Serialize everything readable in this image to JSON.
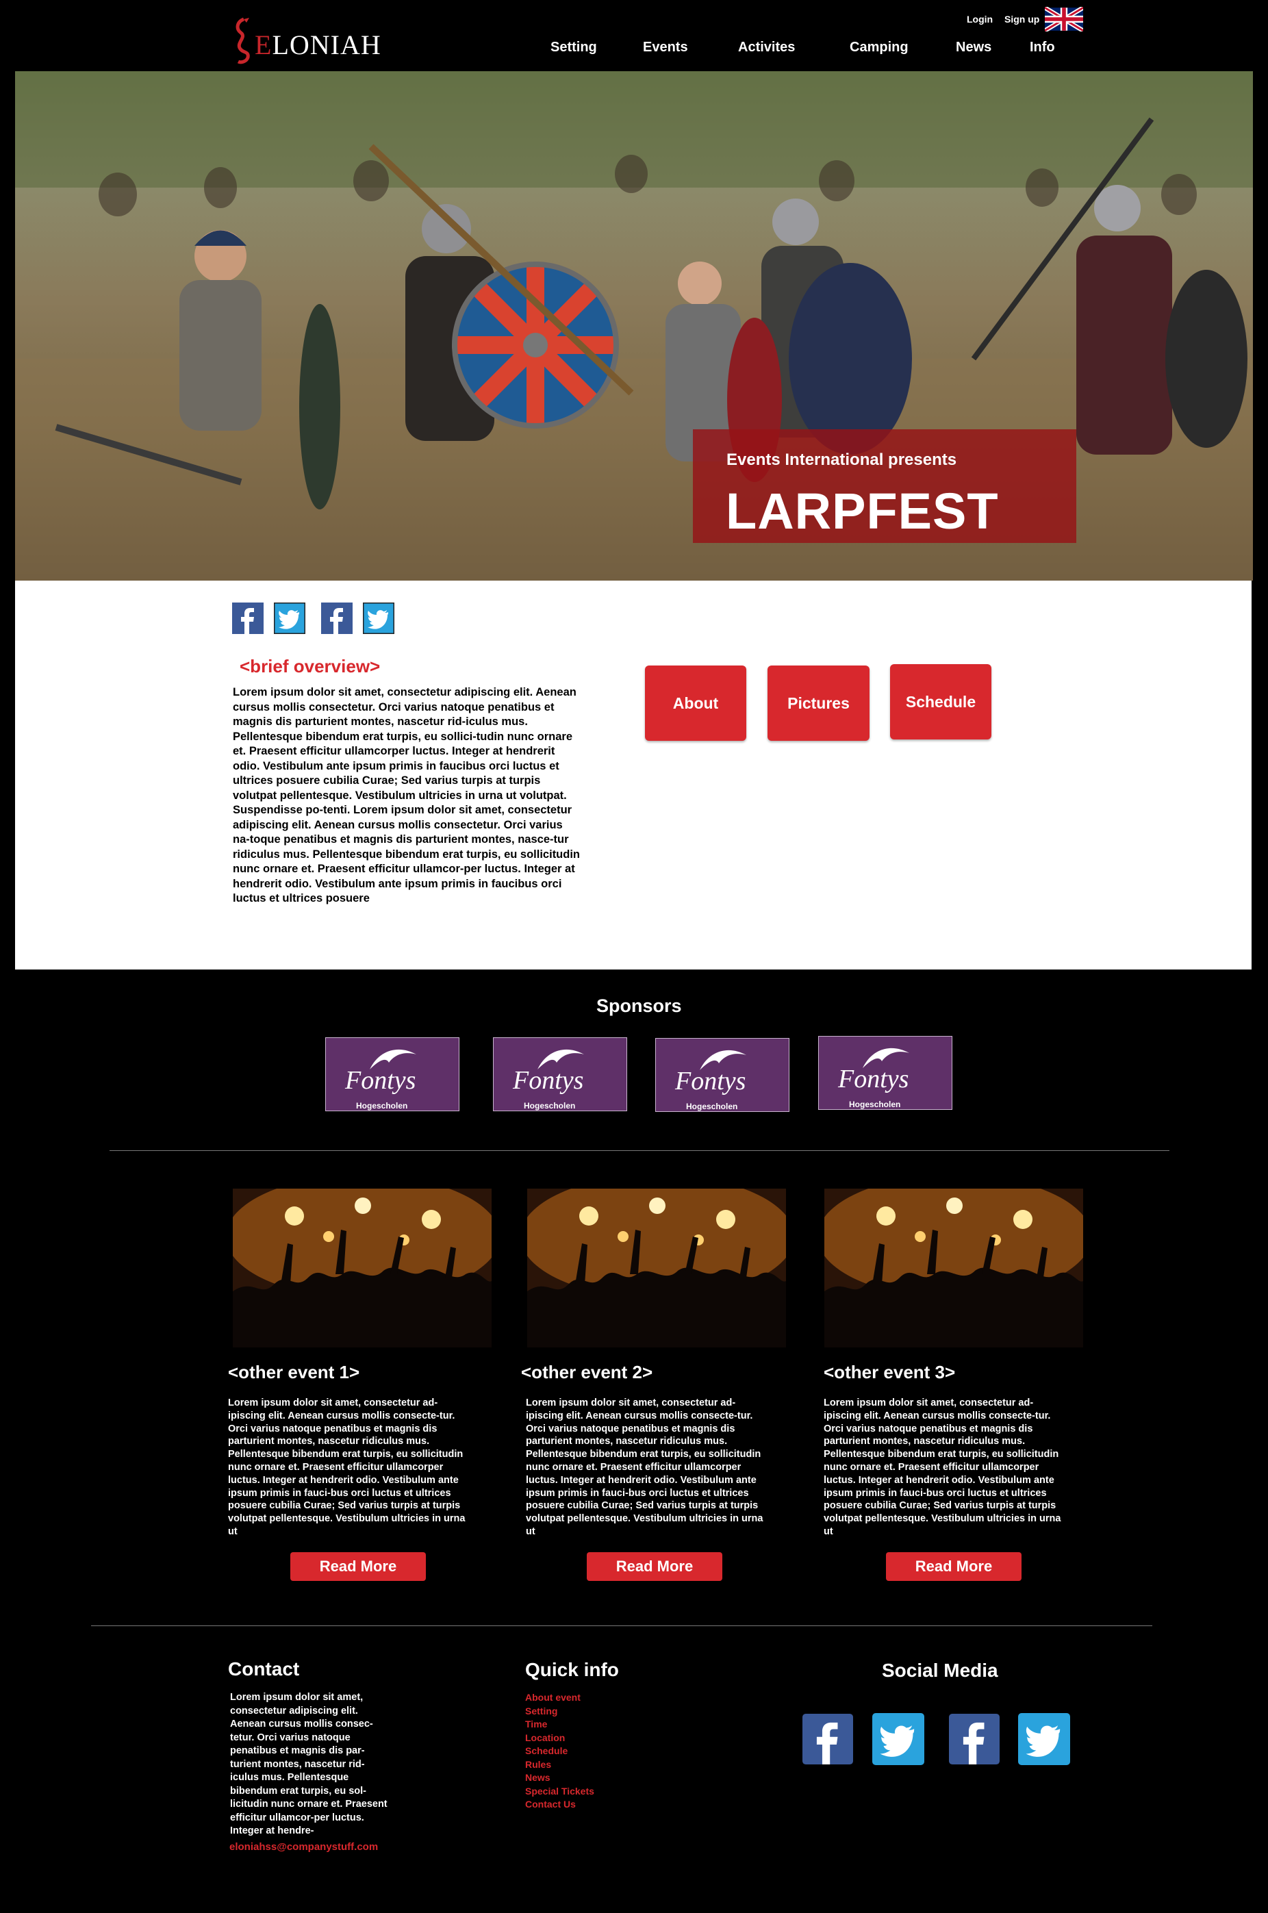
{
  "header": {
    "logo_first_letter": "E",
    "logo_rest": "LONIAH",
    "login": "Login",
    "signup": "Sign up",
    "language_icon": "uk-flag-icon",
    "nav": [
      "Setting",
      "Events",
      "Activites",
      "Camping",
      "News",
      "Info"
    ]
  },
  "hero": {
    "presenter": "Events International presents",
    "title": "LARPFEST"
  },
  "overview": {
    "social_icons": [
      "facebook-icon",
      "twitter-icon",
      "facebook-icon",
      "twitter-icon"
    ],
    "title": "<brief overview>",
    "text": "Lorem ipsum dolor sit amet, consectetur adipiscing elit. Aenean cursus mollis consectetur. Orci varius natoque penatibus et magnis dis parturient montes, nascetur rid-iculus mus. Pellentesque bibendum erat turpis, eu sollici-tudin nunc ornare et. Praesent efficitur ullamcorper luctus. Integer at hendrerit odio. Vestibulum ante ipsum primis in faucibus orci luctus et ultrices posuere cubilia Curae; Sed varius turpis at turpis volutpat pellentesque. Vestibulum ultricies in urna ut volutpat. Suspendisse po-tenti. Lorem ipsum dolor sit amet, consectetur adipiscing elit. Aenean cursus mollis consectetur. Orci varius na-toque penatibus et magnis dis parturient montes, nasce-tur ridiculus mus. Pellentesque bibendum erat turpis, eu sollicitudin nunc ornare et. Praesent efficitur ullamcor-per luctus. Integer at hendrerit odio. Vestibulum ante ipsum primis in faucibus orci luctus et ultrices posuere",
    "buttons": [
      "About",
      "Pictures",
      "Schedule"
    ]
  },
  "sponsors": {
    "title": "Sponsors",
    "items": [
      {
        "name": "Fontys",
        "sub": "Hogescholen"
      },
      {
        "name": "Fontys",
        "sub": "Hogescholen"
      },
      {
        "name": "Fontys",
        "sub": "Hogescholen"
      },
      {
        "name": "Fontys",
        "sub": "Hogescholen"
      }
    ]
  },
  "events": [
    {
      "title": "<other event 1>",
      "text": "Lorem ipsum dolor sit amet, consectetur ad-ipiscing elit. Aenean cursus mollis consecte-tur. Orci varius natoque penatibus et magnis dis parturient montes, nascetur ridiculus mus. Pellentesque bibendum erat turpis, eu sollicitudin nunc ornare et. Praesent efficitur ullamcorper luctus. Integer at hendrerit odio. Vestibulum ante ipsum primis in fauci-bus orci luctus et ultrices posuere cubilia Curae; Sed varius turpis at turpis volutpat pellentesque. Vestibulum ultricies in urna ut",
      "button": "Read More"
    },
    {
      "title": "<other event 2>",
      "text": "Lorem ipsum dolor sit amet, consectetur ad-ipiscing elit. Aenean cursus mollis consecte-tur. Orci varius natoque penatibus et magnis dis parturient montes, nascetur ridiculus mus. Pellentesque bibendum erat turpis, eu sollicitudin nunc ornare et. Praesent efficitur ullamcorper luctus. Integer at hendrerit odio. Vestibulum ante ipsum primis in fauci-bus orci luctus et ultrices posuere cubilia Curae; Sed varius turpis at turpis volutpat pellentesque. Vestibulum ultricies in urna ut",
      "button": "Read More"
    },
    {
      "title": "<other event 3>",
      "text": "Lorem ipsum dolor sit amet, consectetur ad-ipiscing elit. Aenean cursus mollis consecte-tur. Orci varius natoque penatibus et magnis dis parturient montes, nascetur ridiculus mus. Pellentesque bibendum erat turpis, eu sollicitudin nunc ornare et. Praesent efficitur ullamcorper luctus. Integer at hendrerit odio. Vestibulum ante ipsum primis in fauci-bus orci luctus et ultrices posuere cubilia Curae; Sed varius turpis at turpis volutpat pellentesque. Vestibulum ultricies in urna ut",
      "button": "Read More"
    }
  ],
  "footer": {
    "contact": {
      "title": "Contact",
      "text": "Lorem ipsum dolor sit amet, consectetur adipiscing elit. Aenean cursus mollis consec-tetur. Orci varius natoque penatibus et magnis dis par-turient montes, nascetur rid-iculus mus. Pellentesque bibendum erat turpis, eu sol-licitudin nunc ornare et. Praesent efficitur ullamcor-per luctus. Integer at hendre-",
      "email": "eloniahss@companystuff.com"
    },
    "quick_info": {
      "title": "Quick info",
      "links": [
        "About event",
        "Setting",
        "Time",
        "Location",
        "Schedule",
        "Rules",
        "News",
        "Special Tickets",
        "Contact Us"
      ]
    },
    "social": {
      "title": "Social Media",
      "icons": [
        "facebook-icon",
        "twitter-icon",
        "facebook-icon",
        "twitter-icon"
      ]
    }
  },
  "colors": {
    "accent": "#d8282d",
    "background": "#000000",
    "sponsor_purple": "#5f3068",
    "facebook": "#3b5998",
    "twitter": "#2aa3dd"
  }
}
